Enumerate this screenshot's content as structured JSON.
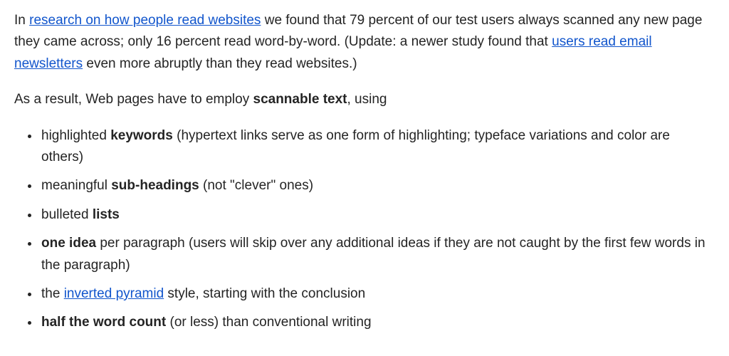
{
  "para1": {
    "t1": "In ",
    "link1": "research on how people read websites",
    "t2": " we found that 79 percent of our test users always scanned any new page they came across; only 16 percent read word-by-word. (Update: a newer study found that ",
    "link2": "users read email newsletters",
    "t3": " even more abruptly than they read websites.)"
  },
  "para2": {
    "t1": "As a result, Web pages have to employ ",
    "bold": "scannable text",
    "t2": ", using"
  },
  "list": {
    "item1": {
      "pre": "highlighted ",
      "bold": "keywords",
      "post": " (hypertext links serve as one form of highlighting; typeface variations and color are others)"
    },
    "item2": {
      "pre": "meaningful ",
      "bold": "sub-headings",
      "post": " (not \"clever\" ones)"
    },
    "item3": {
      "pre": "bulleted ",
      "bold": "lists",
      "post": ""
    },
    "item4": {
      "bold": "one idea",
      "post": " per paragraph (users will skip over any additional ideas if they are not caught by the first few words in the paragraph)"
    },
    "item5": {
      "pre": "the ",
      "link": "inverted pyramid",
      "post": " style, starting with the conclusion"
    },
    "item6": {
      "bold": "half the word count",
      "post": " (or less) than conventional writing"
    }
  }
}
